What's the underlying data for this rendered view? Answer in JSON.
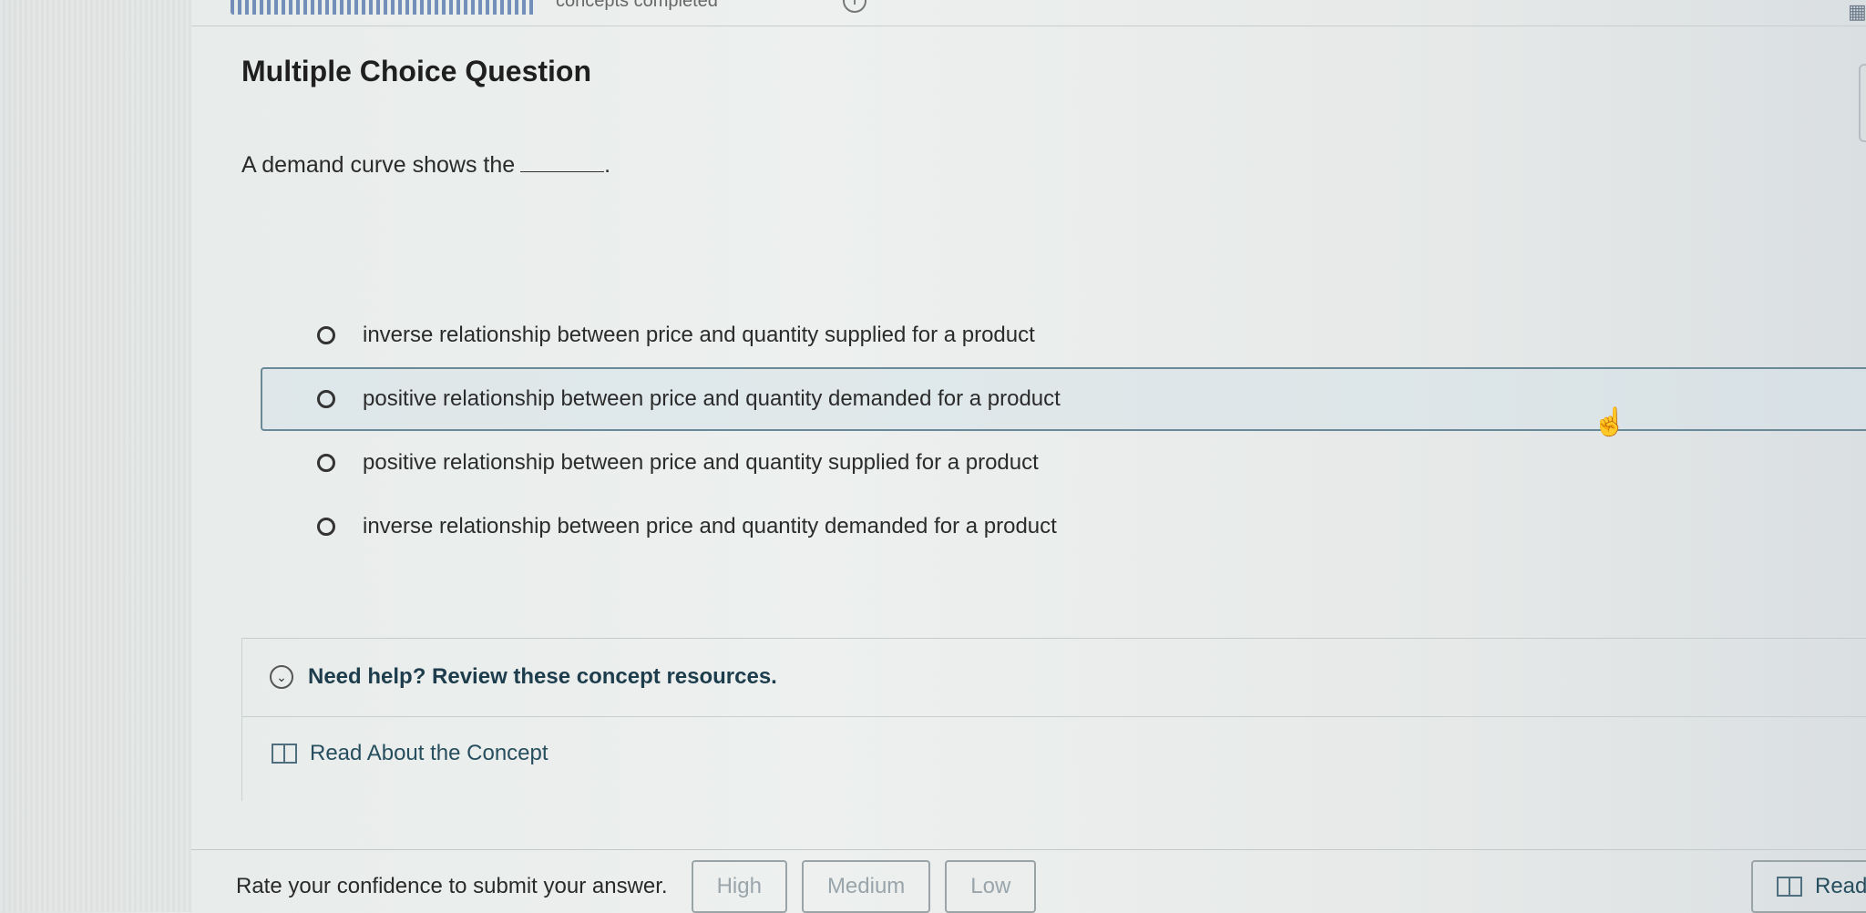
{
  "top_bar": {
    "progress_text": "concepts completed",
    "info_icon": "info-icon"
  },
  "question": {
    "type_title": "Multiple Choice Question",
    "prompt": "A demand curve shows the",
    "prompt_end": "."
  },
  "options": [
    {
      "label": "inverse relationship between price and quantity supplied for a product",
      "highlighted": false
    },
    {
      "label": "positive relationship between price and quantity demanded for a product",
      "highlighted": true
    },
    {
      "label": "positive relationship between price and quantity supplied for a product",
      "highlighted": false
    },
    {
      "label": "inverse relationship between price and quantity demanded for a product",
      "highlighted": false
    }
  ],
  "help": {
    "title": "Need help? Review these concept resources.",
    "read_label": "Read About the Concept",
    "icons": [
      "chevron-down-icon",
      "book-icon"
    ]
  },
  "confidence": {
    "prompt": "Rate your confidence to submit your answer.",
    "high": "High",
    "medium": "Medium",
    "low": "Low"
  },
  "reading": {
    "label": "Readi"
  },
  "colors": {
    "accent": "#264e5e",
    "highlight_border": "#6b8a98",
    "disabled_text": "#9aa5ab"
  }
}
